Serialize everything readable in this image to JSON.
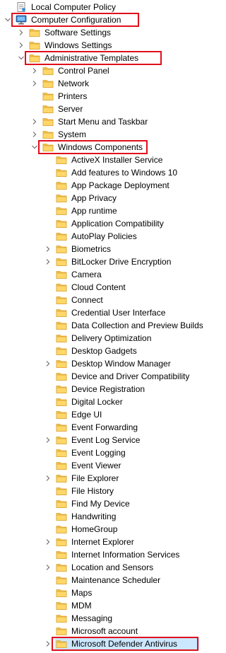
{
  "tree": [
    {
      "label": "Local Computer Policy",
      "level": 0,
      "expander": "none",
      "icon": "policy-icon"
    },
    {
      "label": "Computer Configuration",
      "level": 0,
      "expander": "expanded",
      "icon": "computer-icon",
      "highlighted": true
    },
    {
      "label": "Software Settings",
      "level": 1,
      "expander": "collapsed",
      "icon": "folder-icon"
    },
    {
      "label": "Windows Settings",
      "level": 1,
      "expander": "collapsed",
      "icon": "folder-icon"
    },
    {
      "label": "Administrative Templates",
      "level": 1,
      "expander": "expanded",
      "icon": "folder-icon",
      "highlighted": true
    },
    {
      "label": "Control Panel",
      "level": 2,
      "expander": "collapsed",
      "icon": "folder-icon"
    },
    {
      "label": "Network",
      "level": 2,
      "expander": "collapsed",
      "icon": "folder-icon"
    },
    {
      "label": "Printers",
      "level": 2,
      "expander": "none",
      "icon": "folder-icon"
    },
    {
      "label": "Server",
      "level": 2,
      "expander": "none",
      "icon": "folder-icon"
    },
    {
      "label": "Start Menu and Taskbar",
      "level": 2,
      "expander": "collapsed",
      "icon": "folder-icon"
    },
    {
      "label": "System",
      "level": 2,
      "expander": "collapsed",
      "icon": "folder-icon"
    },
    {
      "label": "Windows Components",
      "level": 2,
      "expander": "expanded",
      "icon": "folder-icon",
      "highlighted": true
    },
    {
      "label": "ActiveX Installer Service",
      "level": 3,
      "expander": "none",
      "icon": "folder-icon"
    },
    {
      "label": "Add features to Windows 10",
      "level": 3,
      "expander": "none",
      "icon": "folder-icon"
    },
    {
      "label": "App Package Deployment",
      "level": 3,
      "expander": "none",
      "icon": "folder-icon"
    },
    {
      "label": "App Privacy",
      "level": 3,
      "expander": "none",
      "icon": "folder-icon"
    },
    {
      "label": "App runtime",
      "level": 3,
      "expander": "none",
      "icon": "folder-icon"
    },
    {
      "label": "Application Compatibility",
      "level": 3,
      "expander": "none",
      "icon": "folder-icon"
    },
    {
      "label": "AutoPlay Policies",
      "level": 3,
      "expander": "none",
      "icon": "folder-icon"
    },
    {
      "label": "Biometrics",
      "level": 3,
      "expander": "collapsed",
      "icon": "folder-icon"
    },
    {
      "label": "BitLocker Drive Encryption",
      "level": 3,
      "expander": "collapsed",
      "icon": "folder-icon"
    },
    {
      "label": "Camera",
      "level": 3,
      "expander": "none",
      "icon": "folder-icon"
    },
    {
      "label": "Cloud Content",
      "level": 3,
      "expander": "none",
      "icon": "folder-icon"
    },
    {
      "label": "Connect",
      "level": 3,
      "expander": "none",
      "icon": "folder-icon"
    },
    {
      "label": "Credential User Interface",
      "level": 3,
      "expander": "none",
      "icon": "folder-icon"
    },
    {
      "label": "Data Collection and Preview Builds",
      "level": 3,
      "expander": "none",
      "icon": "folder-icon"
    },
    {
      "label": "Delivery Optimization",
      "level": 3,
      "expander": "none",
      "icon": "folder-icon"
    },
    {
      "label": "Desktop Gadgets",
      "level": 3,
      "expander": "none",
      "icon": "folder-icon"
    },
    {
      "label": "Desktop Window Manager",
      "level": 3,
      "expander": "collapsed",
      "icon": "folder-icon"
    },
    {
      "label": "Device and Driver Compatibility",
      "level": 3,
      "expander": "none",
      "icon": "folder-icon"
    },
    {
      "label": "Device Registration",
      "level": 3,
      "expander": "none",
      "icon": "folder-icon"
    },
    {
      "label": "Digital Locker",
      "level": 3,
      "expander": "none",
      "icon": "folder-icon"
    },
    {
      "label": "Edge UI",
      "level": 3,
      "expander": "none",
      "icon": "folder-icon"
    },
    {
      "label": "Event Forwarding",
      "level": 3,
      "expander": "none",
      "icon": "folder-icon"
    },
    {
      "label": "Event Log Service",
      "level": 3,
      "expander": "collapsed",
      "icon": "folder-icon"
    },
    {
      "label": "Event Logging",
      "level": 3,
      "expander": "none",
      "icon": "folder-icon"
    },
    {
      "label": "Event Viewer",
      "level": 3,
      "expander": "none",
      "icon": "folder-icon"
    },
    {
      "label": "File Explorer",
      "level": 3,
      "expander": "collapsed",
      "icon": "folder-icon"
    },
    {
      "label": "File History",
      "level": 3,
      "expander": "none",
      "icon": "folder-icon"
    },
    {
      "label": "Find My Device",
      "level": 3,
      "expander": "none",
      "icon": "folder-icon"
    },
    {
      "label": "Handwriting",
      "level": 3,
      "expander": "none",
      "icon": "folder-icon"
    },
    {
      "label": "HomeGroup",
      "level": 3,
      "expander": "none",
      "icon": "folder-icon"
    },
    {
      "label": "Internet Explorer",
      "level": 3,
      "expander": "collapsed",
      "icon": "folder-icon"
    },
    {
      "label": "Internet Information Services",
      "level": 3,
      "expander": "none",
      "icon": "folder-icon"
    },
    {
      "label": "Location and Sensors",
      "level": 3,
      "expander": "collapsed",
      "icon": "folder-icon"
    },
    {
      "label": "Maintenance Scheduler",
      "level": 3,
      "expander": "none",
      "icon": "folder-icon"
    },
    {
      "label": "Maps",
      "level": 3,
      "expander": "none",
      "icon": "folder-icon"
    },
    {
      "label": "MDM",
      "level": 3,
      "expander": "none",
      "icon": "folder-icon"
    },
    {
      "label": "Messaging",
      "level": 3,
      "expander": "none",
      "icon": "folder-icon"
    },
    {
      "label": "Microsoft account",
      "level": 3,
      "expander": "none",
      "icon": "folder-icon"
    },
    {
      "label": "Microsoft Defender Antivirus",
      "level": 3,
      "expander": "collapsed",
      "icon": "folder-icon",
      "highlighted": true,
      "selected": true
    }
  ],
  "colors": {
    "highlight_border": "#e0101b",
    "selection_background": "#cce8ff",
    "folder_fill": "#ffd769",
    "folder_tab": "#f0c24a",
    "folder_outline": "#dba532",
    "chevron": "#6f6f6f"
  }
}
